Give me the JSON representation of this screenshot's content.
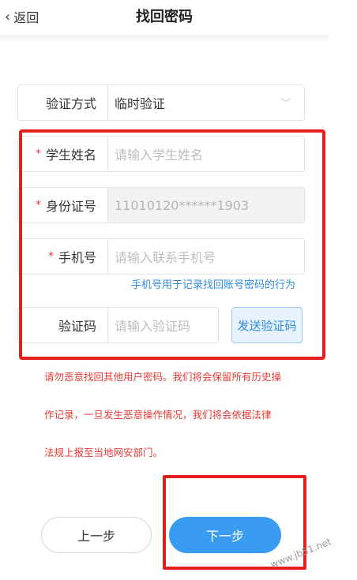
{
  "header": {
    "back_label": "返回",
    "title": "找回密码"
  },
  "form": {
    "verify_method": {
      "label": "验证方式",
      "value": "临时验证"
    },
    "student_name": {
      "required_mark": "*",
      "label": "学生姓名",
      "placeholder": "请输入学生姓名"
    },
    "id_number": {
      "required_mark": "*",
      "label": "身份证号",
      "value": "11010120******1903"
    },
    "phone": {
      "required_mark": "*",
      "label": "手机号",
      "placeholder": "请输入联系手机号",
      "hint": "手机号用于记录找回账号密码的行为"
    },
    "code": {
      "label": "验证码",
      "placeholder": "请输入验证码",
      "send_button": "发送验证码"
    }
  },
  "warning_lines": [
    "请勿恶意找回其他用户密码。我们将会保留所有历史操",
    "作记录，一旦发生恶意操作情况，我们将会依据法律",
    "法规上报至当地网安部门。"
  ],
  "buttons": {
    "prev": "上一步",
    "next": "下一步"
  },
  "watermark": "www.jb51.net",
  "colors": {
    "accent": "#3a9cf0",
    "warning": "#e53935",
    "highlight_frame": "#e41e1e"
  },
  "icons": {
    "back": "chevron-left-icon",
    "dropdown": "chevron-down-icon"
  }
}
